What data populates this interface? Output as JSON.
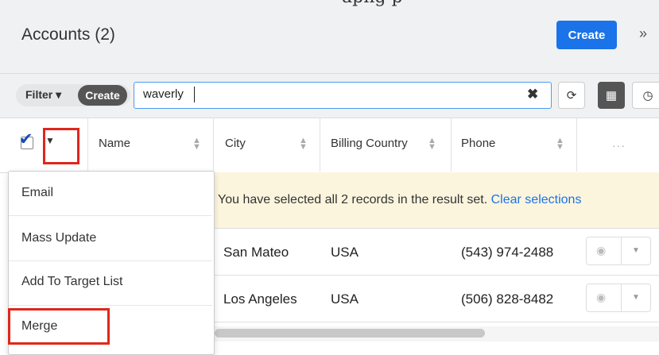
{
  "page_title": "Accounts (2)",
  "header": {
    "create_label": "Create",
    "expand_icon": "»"
  },
  "filter": {
    "filter_label": "Filter ▾",
    "create_label": "Create",
    "search_value": "waverly",
    "clear_icon": "✖"
  },
  "toolbar": {
    "refresh_icon": "⟳",
    "listview_icon": "▦",
    "clock_icon": "◷"
  },
  "columns": [
    {
      "label": "Name"
    },
    {
      "label": "City"
    },
    {
      "label": "Billing Country"
    },
    {
      "label": "Phone"
    }
  ],
  "more_columns": "···",
  "banner": {
    "text": "You have selected all 2 records in the result set.",
    "link": "Clear selections"
  },
  "rows": [
    {
      "city": "San Mateo",
      "country": "USA",
      "phone": "(543) 974-2488"
    },
    {
      "city": "Los Angeles",
      "country": "USA",
      "phone": "(506) 828-8482"
    }
  ],
  "menu": {
    "items": [
      "Email",
      "Mass Update",
      "Add To Target List",
      "Merge"
    ]
  },
  "top_clipped_text": "apng p",
  "colors": {
    "accent": "#1a73e8",
    "highlight": "#e0261b",
    "banner_bg": "#fcf5dd"
  }
}
